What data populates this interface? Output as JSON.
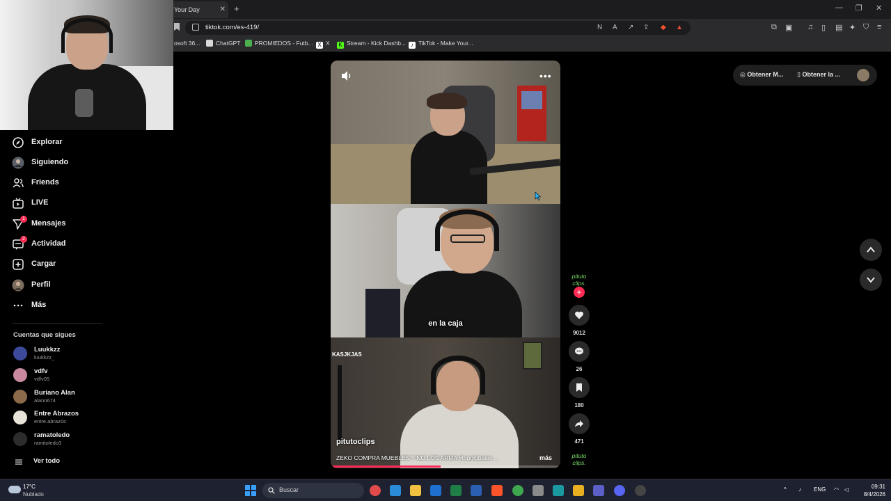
{
  "browser": {
    "tab_title": "Your Day",
    "url": "tiktok.com/es-419/",
    "bookmarks": [
      {
        "label": "osoft 36...",
        "color": "#d9d9d9"
      },
      {
        "label": "ChatGPT",
        "color": "#d9d9d9"
      },
      {
        "label": "PROMIEDOS - Futb...",
        "color": "#4caf50"
      },
      {
        "label": "X",
        "color": "#ffffff"
      },
      {
        "label": "Stream - Kick Dashb...",
        "color": "#53fc18"
      },
      {
        "label": "TikTok - Make Your...",
        "color": "#ffffff"
      }
    ]
  },
  "sidebar": {
    "items": [
      {
        "label": "Explorar",
        "icon": "compass-icon",
        "badge": ""
      },
      {
        "label": "Siguiendo",
        "icon": "following-avatar-icon",
        "badge": ""
      },
      {
        "label": "Friends",
        "icon": "friends-icon",
        "badge": ""
      },
      {
        "label": "LIVE",
        "icon": "live-icon",
        "badge": ""
      },
      {
        "label": "Mensajes",
        "icon": "messages-icon",
        "badge": "1"
      },
      {
        "label": "Actividad",
        "icon": "activity-icon",
        "badge": "2"
      },
      {
        "label": "Cargar",
        "icon": "upload-icon",
        "badge": ""
      },
      {
        "label": "Perfil",
        "icon": "profile-avatar-icon",
        "badge": ""
      },
      {
        "label": "Más",
        "icon": "more-icon",
        "badge": ""
      }
    ],
    "following_title": "Cuentas que sigues",
    "following": [
      {
        "name": "Luukkzz",
        "handle": "luukkzz_",
        "color": "#3b4a9a"
      },
      {
        "name": "vdfv",
        "handle": "vdfv05",
        "color": "#c98aa0"
      },
      {
        "name": "Buriano Alan",
        "handle": "alann674",
        "color": "#8a6a4a"
      },
      {
        "name": "Entre Abrazos",
        "handle": "entre.abrazos",
        "color": "#e8e2d8"
      },
      {
        "name": "ramatoledo",
        "handle": "ramitoledo3",
        "color": "#2c2c2c"
      }
    ],
    "see_all": "Ver todo"
  },
  "video": {
    "caption": "en la caja",
    "overlay_tag": "KASJKJAS",
    "author": "pitutoclips",
    "description": "ZEKO COMPRA MUEBLES Y NO LOS ARMA #topglobales ...",
    "more": "más",
    "progress": 0.48
  },
  "actions": {
    "creator_logo": "pituto clips.",
    "likes": "9012",
    "comments": "26",
    "saves": "180",
    "shares": "471",
    "bottom_logo": "pituto clips."
  },
  "topright": {
    "get_app_1": "Obtener M...",
    "get_app_2": "Obtener la ..."
  },
  "taskbar": {
    "temperature": "17°C",
    "weather": "Nublado",
    "search_placeholder": "Buscar",
    "language": "ENG",
    "time": "09:31",
    "date": "8/4/2026"
  }
}
